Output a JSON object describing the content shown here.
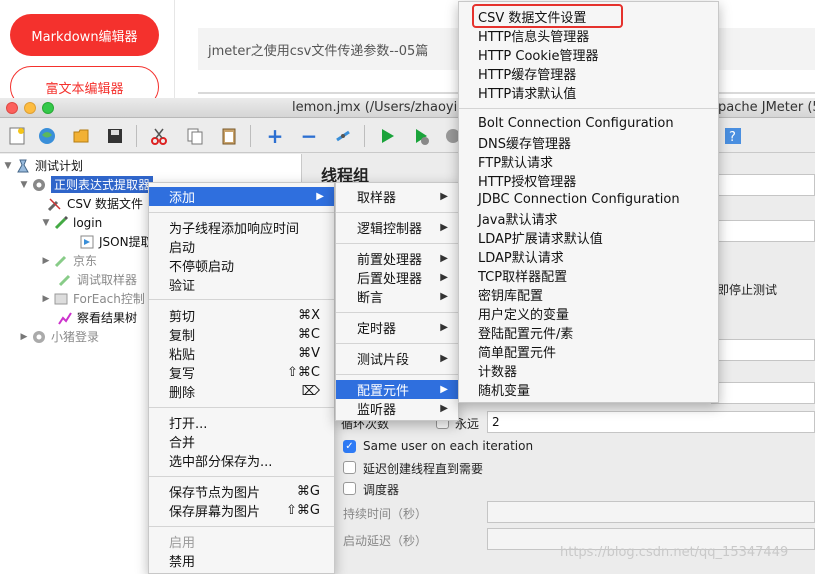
{
  "blog": {
    "markdown_btn": "Markdown编辑器",
    "richtext_btn": "富文本编辑器",
    "article_title": "jmeter之使用csv文件传递参数--05篇",
    "watermark": "https://blog.csdn.net/qq_15347449"
  },
  "window": {
    "title_left": "lemon.jmx (/Users/zhaoyin",
    "title_right": "pache JMeter (5"
  },
  "tree": {
    "test_plan": "测试计划",
    "thread_group": "正则表达式提取器",
    "csv": "CSV 数据文件",
    "login": "login",
    "json": "JSON提取",
    "jd": "京东",
    "debug": "调试取样器",
    "foreach": "ForEach控制",
    "results": "察看结果树",
    "pig": "小猪登录"
  },
  "panel": {
    "title": "线程组",
    "stop_text": "立即停止测试",
    "loop_label": "循环次数",
    "forever_label": "永远",
    "loop_value": "2",
    "same_user": "Same user on each iteration",
    "delay_create": "延迟创建线程直到需要",
    "scheduler": "调度器",
    "duration": "持续时间（秒）",
    "startup_delay": "启动延迟（秒）"
  },
  "menu1": {
    "add": "添加",
    "add_think": "为子线程添加响应时间",
    "start": "启动",
    "start_no_pause": "不停顿启动",
    "validate": "验证",
    "cut": "剪切",
    "cut_sc": "⌘X",
    "copy": "复制",
    "copy_sc": "⌘C",
    "paste": "粘贴",
    "paste_sc": "⌘V",
    "duplicate": "复写",
    "duplicate_sc": "⇧⌘C",
    "delete": "删除",
    "delete_sc": "⌦",
    "open": "打开...",
    "merge": "合并",
    "save_selection": "选中部分保存为...",
    "save_node_img": "保存节点为图片",
    "save_node_img_sc": "⌘G",
    "save_screen_img": "保存屏幕为图片",
    "save_screen_img_sc": "⇧⌘G",
    "enable": "启用",
    "disable": "禁用"
  },
  "menu2": {
    "sampler": "取样器",
    "logic": "逻辑控制器",
    "pre": "前置处理器",
    "post": "后置处理器",
    "assert": "断言",
    "timer": "定时器",
    "fragment": "测试片段",
    "config": "配置元件",
    "listener": "监听器"
  },
  "menu3": {
    "items": [
      "CSV 数据文件设置",
      "HTTP信息头管理器",
      "HTTP Cookie管理器",
      "HTTP缓存管理器",
      "HTTP请求默认值",
      "Bolt Connection Configuration",
      "DNS缓存管理器",
      "FTP默认请求",
      "HTTP授权管理器",
      "JDBC Connection Configuration",
      "Java默认请求",
      "LDAP扩展请求默认值",
      "LDAP默认请求",
      "TCP取样器配置",
      "密钥库配置",
      "用户定义的变量",
      "登陆配置元件/素",
      "简单配置元件",
      "计数器",
      "随机变量"
    ]
  },
  "colors": {
    "accent_red": "#f4312d",
    "selection_blue": "#2f65ca",
    "menu_highlight": "#2f6fde"
  }
}
